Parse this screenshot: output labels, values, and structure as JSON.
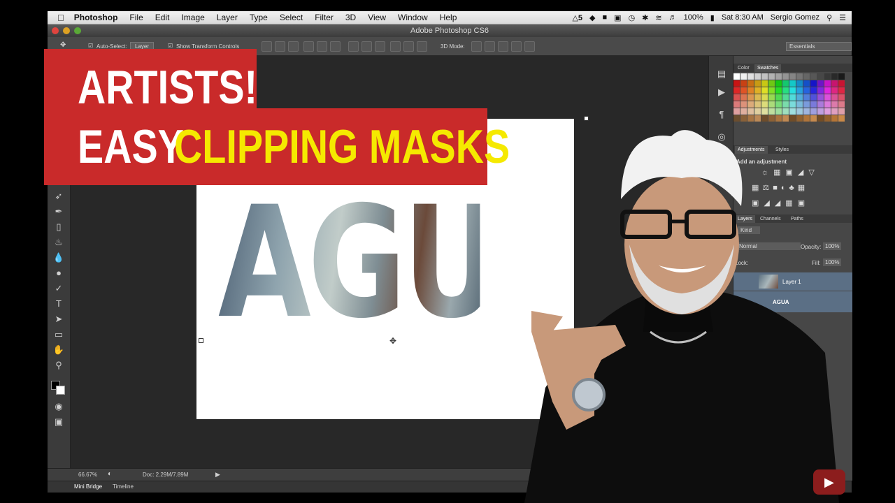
{
  "menubar": {
    "apple": "",
    "app_name": "Photoshop",
    "items": [
      "File",
      "Edit",
      "Image",
      "Layer",
      "Type",
      "Select",
      "Filter",
      "3D",
      "View",
      "Window",
      "Help"
    ],
    "status": {
      "badge": "5",
      "battery": "100%",
      "clock": "Sat 8:30 AM",
      "user": "Sergio Gomez"
    }
  },
  "window": {
    "title": "Adobe Photoshop CS6"
  },
  "options_bar": {
    "auto_select_label": "Auto-Select:",
    "auto_select_value": "Layer",
    "show_transform_label": "Show Transform Controls",
    "mode_3d_label": "3D Mode:",
    "workspace": "Essentials"
  },
  "canvas": {
    "text": "AGUA"
  },
  "status_bar": {
    "zoom": "66.67%",
    "doc": "Doc: 2.29M/7.89M"
  },
  "bottom_tabs": [
    "Mini Bridge",
    "Timeline"
  ],
  "panels": {
    "color_tabs": [
      "Color",
      "Swatches"
    ],
    "adjust_tabs": [
      "Adjustments",
      "Styles"
    ],
    "add_adjustment": "Add an adjustment",
    "layers_tabs": [
      "Layers",
      "Channels",
      "Paths"
    ],
    "kind_label": "Kind",
    "blend_mode": "Normal",
    "opacity_label": "Opacity:",
    "opacity_value": "100%",
    "lock_label": "Lock:",
    "fill_label": "Fill:",
    "fill_value": "100%",
    "layers": [
      "Layer 1",
      "AGUA"
    ]
  },
  "banner": {
    "line1": "ARTISTS!",
    "line2_white": "EASY",
    "line2_yellow": "CLIPPING MASKS"
  },
  "colors": {
    "banner_red": "#c92a2a",
    "highlight_yellow": "#f5e900"
  }
}
